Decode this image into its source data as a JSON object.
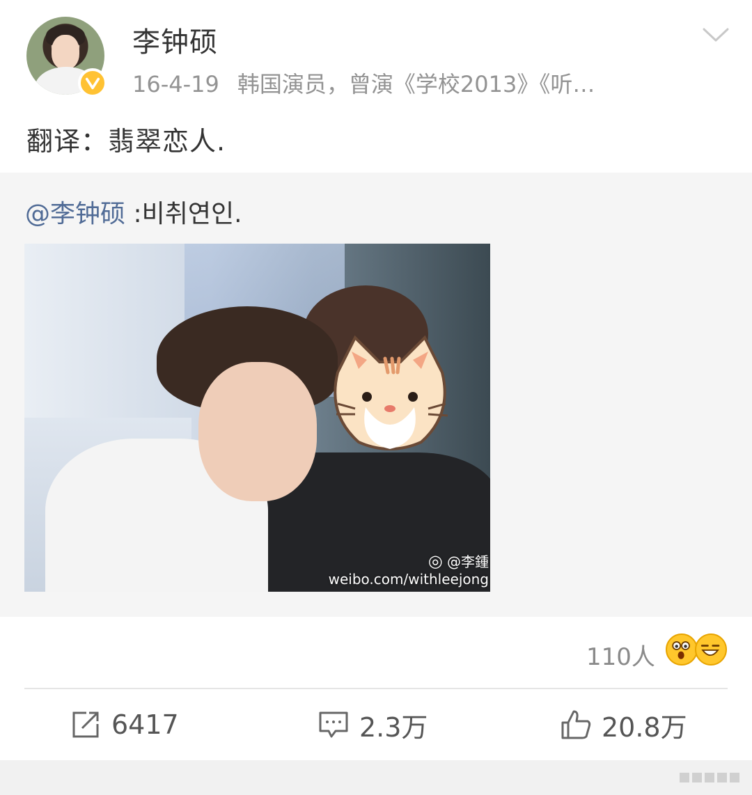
{
  "header": {
    "username": "李钟硕",
    "date": "16-4-19",
    "description": "韩国演员，曾演《学校2013》《听…"
  },
  "post": {
    "text": "翻译：翡翠恋人."
  },
  "repost": {
    "mention": "@李钟硕",
    "text": " :비취연인.",
    "watermark_handle": "@李鍾",
    "watermark_url": "weibo.com/withleejong"
  },
  "reactions": {
    "count": "110人"
  },
  "actions": {
    "reposts": "6417",
    "comments": "2.3万",
    "likes": "20.8万"
  },
  "colors": {
    "mention": "#506b96",
    "verified_badge": "#ffc233",
    "repost_bg": "#f5f5f5"
  }
}
